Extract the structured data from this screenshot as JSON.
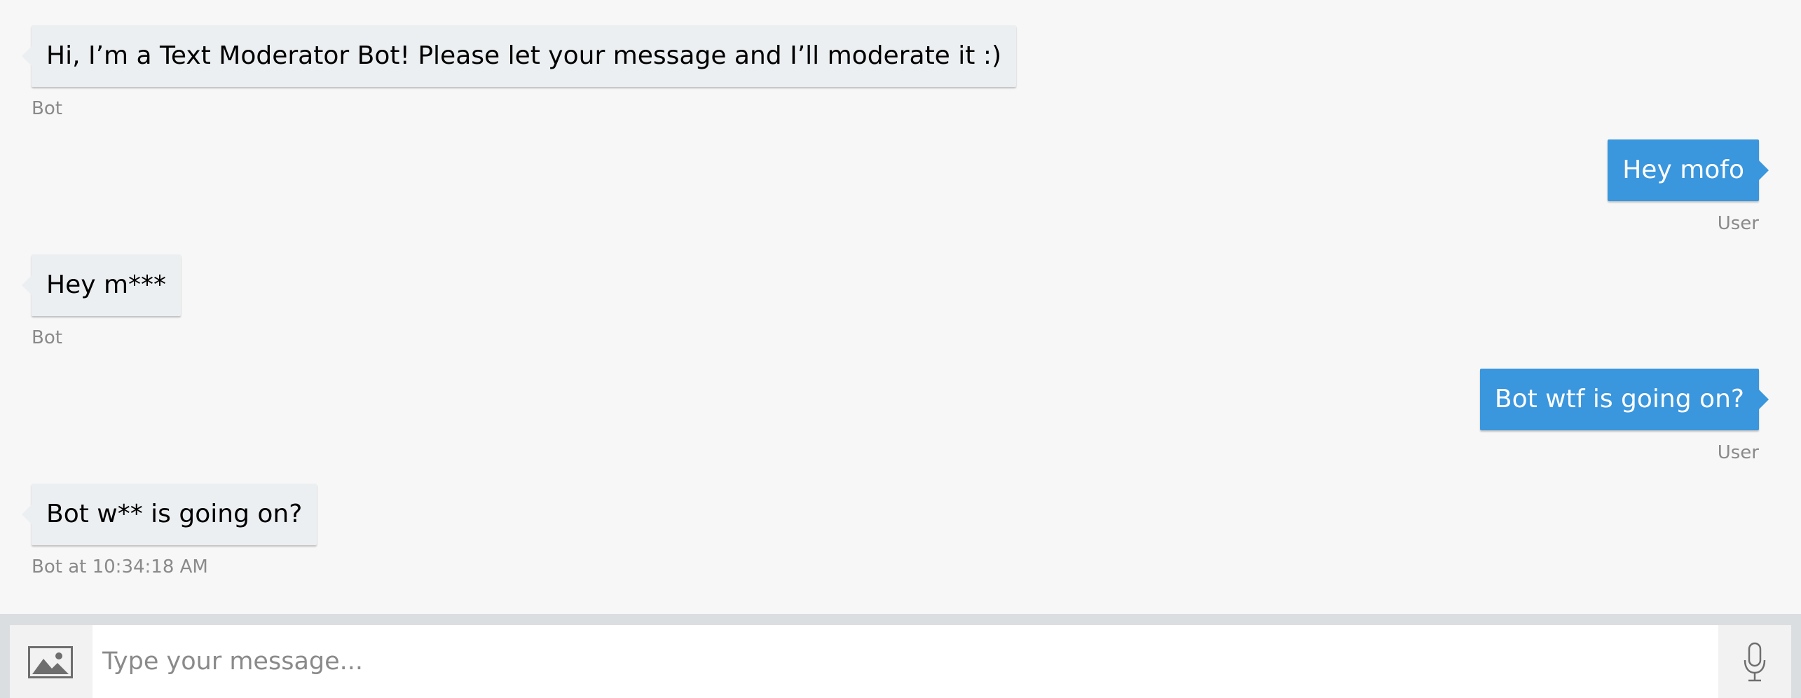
{
  "messages": [
    {
      "from": "bot",
      "text": "Hi, I’m a Text Moderator Bot! Please let your message and I’ll moderate it :)",
      "meta": "Bot"
    },
    {
      "from": "user",
      "text": "Hey mofo",
      "meta": "User"
    },
    {
      "from": "bot",
      "text": "Hey m***",
      "meta": "Bot"
    },
    {
      "from": "user",
      "text": "Bot wtf is going on?",
      "meta": "User"
    },
    {
      "from": "bot",
      "text": "Bot w** is going on?",
      "meta": "Bot at 10:34:18 AM"
    }
  ],
  "composer": {
    "placeholder": "Type your message...",
    "value": "",
    "upload_icon": "image-icon",
    "mic_icon": "microphone-icon"
  },
  "colors": {
    "background": "#f7f7f7",
    "bot_bubble": "#eceff1",
    "user_bubble": "#3a96dd",
    "meta_text": "#8a8a8a"
  }
}
